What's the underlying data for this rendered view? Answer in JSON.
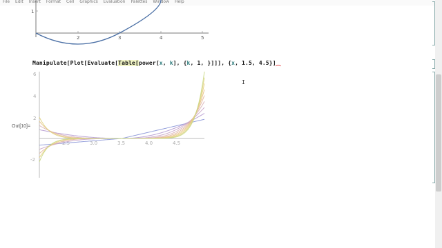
{
  "menubar": {
    "items": [
      "File",
      "Edit",
      "Insert",
      "Format",
      "Cell",
      "Graphics",
      "Evaluation",
      "Palettes",
      "Window",
      "Help"
    ]
  },
  "top_plot": {
    "y_tick_labels": [
      "1"
    ],
    "x_tick_labels": [
      "2",
      "3",
      "4",
      "5"
    ]
  },
  "input_cell": {
    "code_before": "Manipulate[Plot[Evaluate[",
    "code_table": "Table[",
    "code_after_table": "power[",
    "code_x": "x",
    "code_comma1": ", ",
    "code_k": "k",
    "code_mid": "], {",
    "code_k2": "k",
    "code_mid2": ", 1, ",
    "code_bracket_end": "}]]], {",
    "code_x2": "x",
    "code_tail": ", 1.5, 4.5}]",
    "code_err": "⁔"
  },
  "output": {
    "label": "Out[10]="
  },
  "main_plot": {
    "y_tick_labels": [
      "6",
      "4",
      "2",
      "-2"
    ],
    "x_tick_labels": [
      "2.5",
      "3.0",
      "3.5",
      "4.0",
      "4.5"
    ]
  },
  "cursor_glyph": "I",
  "colors": {
    "top_curve": "#4a6fa5",
    "series": [
      "#8a96d8",
      "#b59ad0",
      "#c9a5c8",
      "#d9b1b6",
      "#e3b69a",
      "#e6c086",
      "#e8cf7e",
      "#dfd27f",
      "#c9d884"
    ],
    "accent": "#2c7a7b",
    "error": "#dd1111"
  }
}
